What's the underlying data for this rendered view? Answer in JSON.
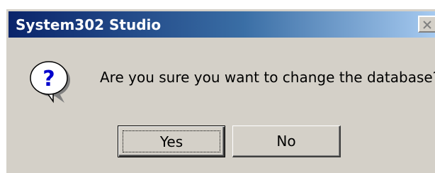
{
  "window": {
    "title": "System302 Studio",
    "close_icon": "close-icon"
  },
  "dialog": {
    "icon": "question-icon",
    "message": "Are you sure you want to change the database?"
  },
  "buttons": {
    "yes_label": "Yes",
    "no_label": "No"
  },
  "colors": {
    "titlebar_start": "#0a246a",
    "titlebar_end": "#a6caf0",
    "dialog_bg": "#d4d0c8",
    "icon_blue": "#0000cc"
  }
}
